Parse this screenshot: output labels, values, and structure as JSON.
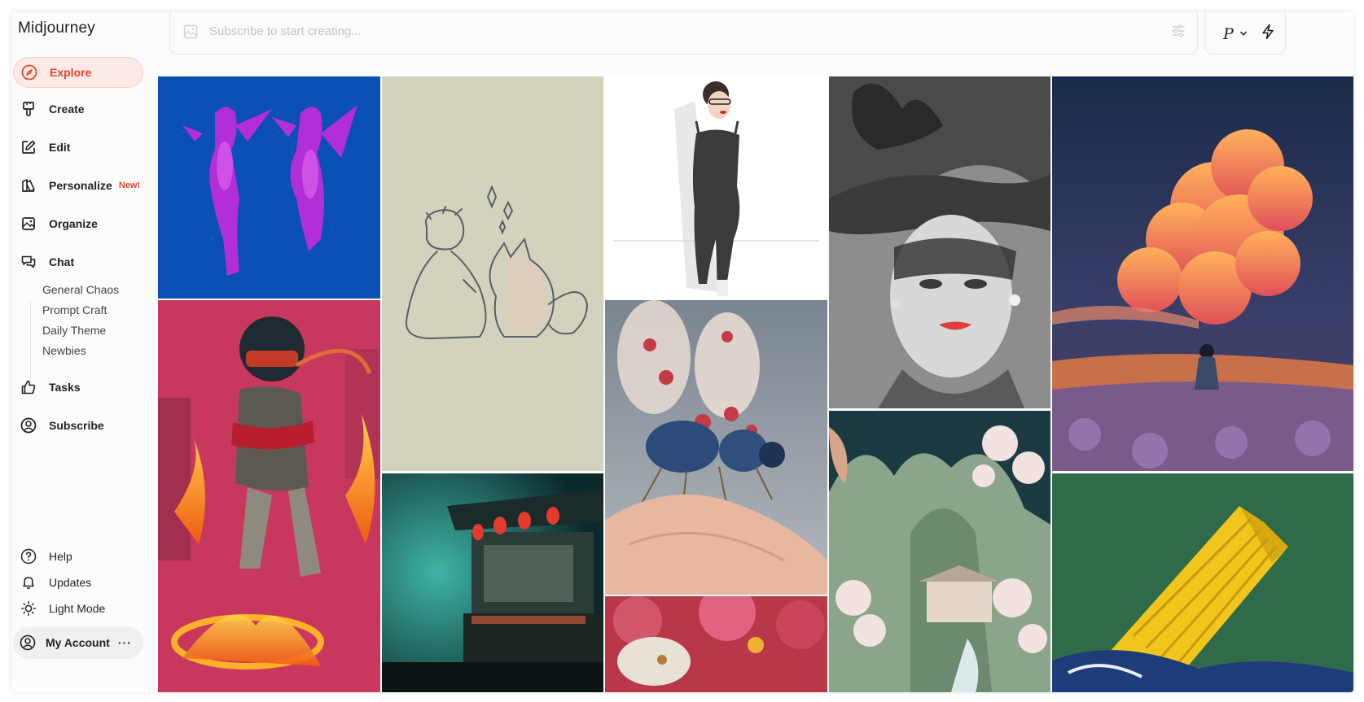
{
  "app": {
    "brand": "Midjourney"
  },
  "nav": {
    "explore": "Explore",
    "create": "Create",
    "edit": "Edit",
    "personalize": "Personalize",
    "personalize_badge": "New!",
    "organize": "Organize",
    "chat": "Chat",
    "chat_rooms": [
      "General Chaos",
      "Prompt Craft",
      "Daily Theme",
      "Newbies"
    ],
    "tasks": "Tasks",
    "subscribe": "Subscribe"
  },
  "bottom": {
    "help": "Help",
    "updates": "Updates",
    "light_mode": "Light Mode",
    "account": "My Account"
  },
  "search": {
    "placeholder": "Subscribe to start creating..."
  },
  "toolbar": {
    "personalize_toggle": "P"
  },
  "gallery": {
    "images": [
      "purple-angels-statues",
      "boy-and-fox-sketch",
      "woman-in-black-jumpsuit",
      "woman-with-feathered-hat",
      "sunset-clouds-field",
      "masked-warrior-fire",
      "neon-street-food-stall",
      "floral-jeweled-bee",
      "chinese-landscape-painting",
      "red-flowers-fish",
      "yellow-shipping-container"
    ]
  },
  "colors": {
    "accent": "#e8452c",
    "active_bg": "#fde9e5"
  }
}
